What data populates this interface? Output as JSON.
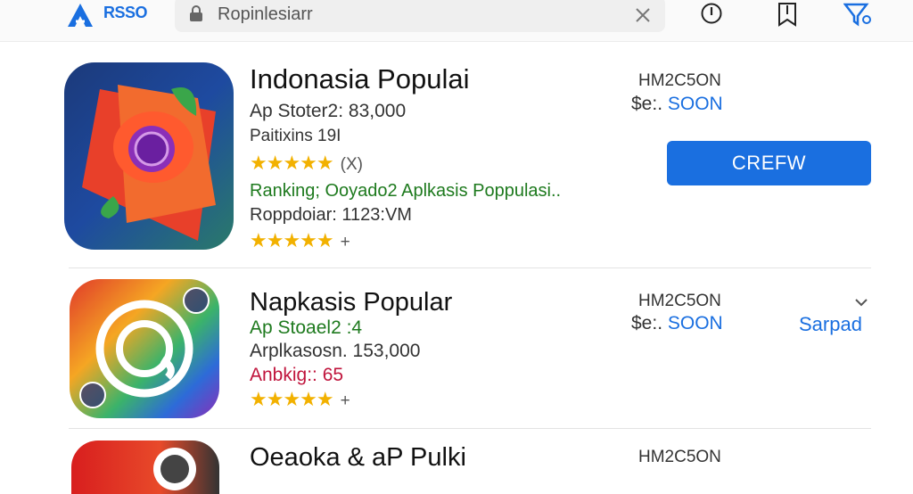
{
  "header": {
    "logo_text": "RSSO",
    "search_placeholder": "Ropinlesiarr"
  },
  "apps": [
    {
      "title": "Indonasia Populai",
      "line1": "Ap Stoter2: 83,000",
      "line2": "Paitixins 19I",
      "stars1_extra": "(X)",
      "line3": "Ranking; Ooyado2 Aplkasis Poppulasi..",
      "line4": "Roppdoiar: 1123:VM",
      "stars2_extra": "+",
      "meta1": "HM2C5ON",
      "meta2_prefix": "$e:.",
      "meta2_suffix": "SOON",
      "button_label": "CREFW"
    },
    {
      "title": "Napkasis Popular",
      "line1": "Ap Stoael2 :4",
      "line2": "Arplkasosn. 153,000",
      "line3": "Anbkig:: 65",
      "stars_extra": "+",
      "meta1": "HM2C5ON",
      "meta2_prefix": "$e:.",
      "meta2_suffix": "SOON",
      "link_label": "Sarpad"
    },
    {
      "title": "Oeaoka & aP Pulki",
      "meta1": "HM2C5ON"
    }
  ],
  "colors": {
    "accent": "#1a6fe0",
    "star": "#f2b100",
    "green_text": "#1e7a1e",
    "red_text": "#c0143c"
  },
  "icons": [
    "app-store-logo-icon",
    "lock-icon",
    "clear-icon",
    "alert-circle-icon",
    "bookmark-icon",
    "filter-icon",
    "chevron-down-icon"
  ]
}
